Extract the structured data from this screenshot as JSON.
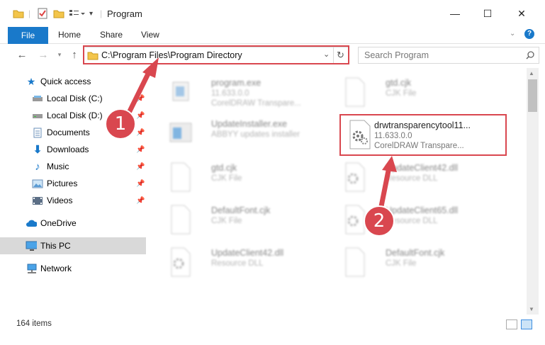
{
  "window": {
    "title": "Program",
    "minimize_glyph": "—",
    "maximize_glyph": "☐",
    "close_glyph": "✕"
  },
  "ribbon": {
    "tabs": [
      "File",
      "Home",
      "Share",
      "View"
    ],
    "help_glyph": "?"
  },
  "address_bar": {
    "path": "C:\\Program Files\\Program Directory",
    "search_placeholder": "Search Program"
  },
  "sidebar": {
    "quick_access": "Quick access",
    "items": [
      {
        "label": "Local Disk (C:)",
        "icon": "drive-icon",
        "pinned": true
      },
      {
        "label": "Local Disk (D:)",
        "icon": "drive-icon",
        "pinned": true
      },
      {
        "label": "Documents",
        "icon": "documents-icon",
        "pinned": true
      },
      {
        "label": "Downloads",
        "icon": "downloads-icon",
        "pinned": true
      },
      {
        "label": "Music",
        "icon": "music-icon",
        "pinned": true
      },
      {
        "label": "Pictures",
        "icon": "pictures-icon",
        "pinned": true
      },
      {
        "label": "Videos",
        "icon": "videos-icon",
        "pinned": true
      }
    ],
    "onedrive": "OneDrive",
    "this_pc": "This PC",
    "network": "Network"
  },
  "files": [
    {
      "name": "program.exe",
      "line2": "11.633.0.0",
      "line3": "CorelDRAW Transpare...",
      "icon": "exe-icon",
      "blurred": true
    },
    {
      "name": "gtd.cjk",
      "line2": "CJK File",
      "line3": "",
      "icon": "blank-file-icon",
      "blurred": true
    },
    {
      "name": "UpdateInstaller.exe",
      "line2": "ABBYY updates installer",
      "line3": "",
      "icon": "installer-icon",
      "blurred": true
    },
    {
      "name": "drwtransparencytool11...",
      "line2": "11.633.0.0",
      "line3": "CorelDRAW Transpare...",
      "icon": "dll-gear-icon",
      "blurred": false
    },
    {
      "name": "gtd.cjk",
      "line2": "CJK File",
      "line3": "",
      "icon": "blank-file-icon",
      "blurred": true
    },
    {
      "name": "UpdateClient42.dll",
      "line2": "Resource DLL",
      "line3": "",
      "icon": "dll-gear-icon",
      "blurred": true
    },
    {
      "name": "DefaultFont.cjk",
      "line2": "CJK File",
      "line3": "",
      "icon": "blank-file-icon",
      "blurred": true
    },
    {
      "name": "UpdateClient65.dll",
      "line2": "Resource DLL",
      "line3": "",
      "icon": "dll-gear-icon",
      "blurred": true
    },
    {
      "name": "UpdateClient42.dll",
      "line2": "Resource DLL",
      "line3": "",
      "icon": "dll-gear-icon",
      "blurred": true
    },
    {
      "name": "DefaultFont.cjk",
      "line2": "CJK File",
      "line3": "",
      "icon": "blank-file-icon",
      "blurred": true
    }
  ],
  "status": {
    "items_count": "164 items"
  },
  "annotations": {
    "badge_1": "1",
    "badge_2": "2",
    "color": "#d9474f"
  }
}
